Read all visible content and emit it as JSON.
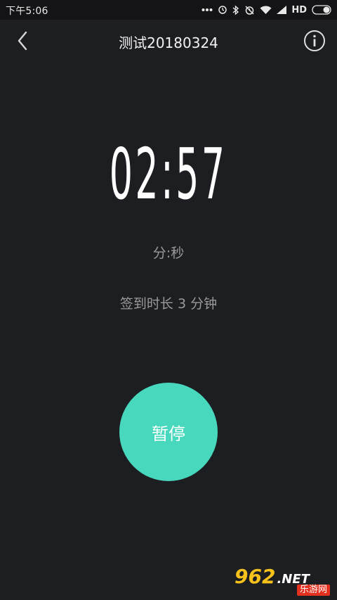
{
  "status_bar": {
    "time": "下午5:06",
    "network_label": "HD",
    "icons": [
      "more-dots-icon",
      "sync-icon",
      "bluetooth-icon",
      "alarm-off-icon",
      "wifi-icon",
      "signal-icon",
      "battery-icon"
    ]
  },
  "header": {
    "title": "测试20180324",
    "back_icon": "chevron-left-icon",
    "info_icon": "info-circle-icon"
  },
  "timer": {
    "value": "02:57",
    "unit_label": "分:秒",
    "duration_text": "签到时长 3 分钟"
  },
  "controls": {
    "pause_label": "暂停"
  },
  "watermark": {
    "digits": "962",
    "suffix": ".NET",
    "site_name": "乐游网"
  },
  "colors": {
    "background": "#1d1e22",
    "status_bar": "#141416",
    "accent": "#47d8bd",
    "secondary_text": "#9a9a9e",
    "watermark_yellow": "#f7c21a",
    "watermark_red": "#e3301f"
  }
}
